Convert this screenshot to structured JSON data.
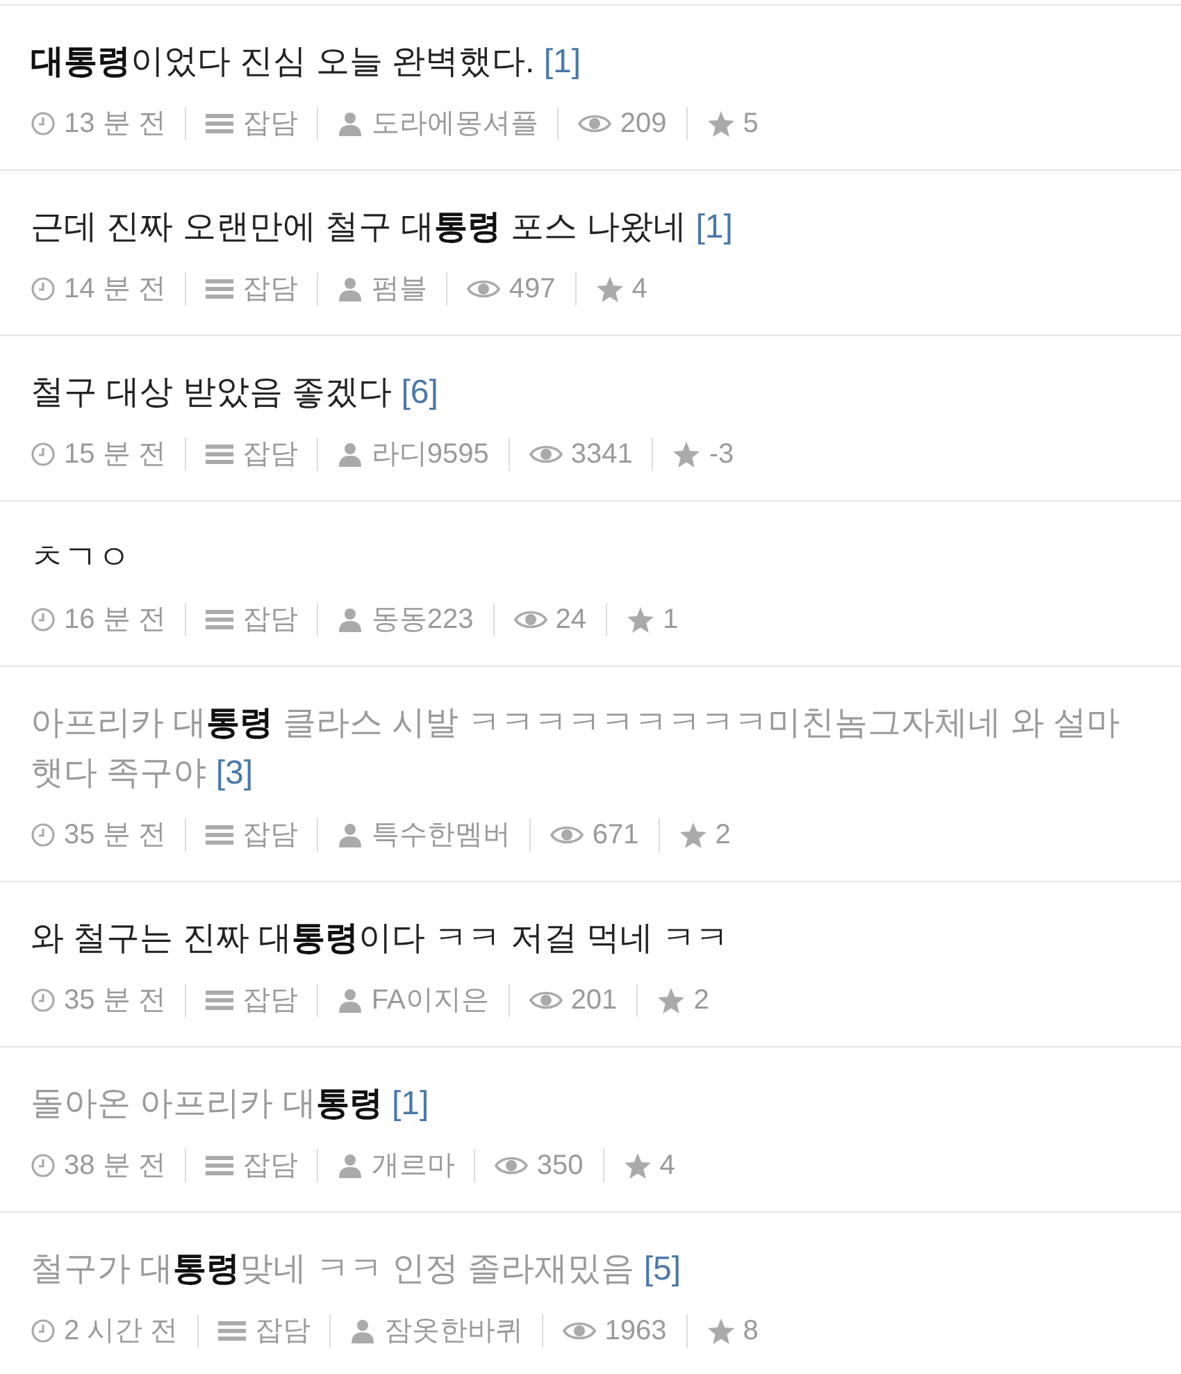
{
  "posts": [
    {
      "title": "**대통령**이었다 진심 오늘 완벽했다.",
      "comments": "[1]",
      "read": false,
      "time": "13 분 전",
      "category": "잡담",
      "author": "도라에몽셔플",
      "views": "209",
      "votes": "5"
    },
    {
      "title": "근데 진짜 오랜만에 철구 대**통령** 포스 나왔네",
      "comments": "[1]",
      "read": false,
      "time": "14 분 전",
      "category": "잡담",
      "author": "펌블",
      "views": "497",
      "votes": "4"
    },
    {
      "title": "철구 대상 받았음 좋겠다",
      "comments": "[6]",
      "read": false,
      "time": "15 분 전",
      "category": "잡담",
      "author": "라디9595",
      "views": "3341",
      "votes": "-3"
    },
    {
      "title": "ㅊㄱㅇ",
      "read": false,
      "time": "16 분 전",
      "category": "잡담",
      "author": "동동223",
      "views": "24",
      "votes": "1"
    },
    {
      "title": "아프리카 대**통령** 클라스 시발 ㅋㅋㅋㅋㅋㅋㅋㅋㅋ미친놈그자체네 와 설마햇다 족구야",
      "comments": "[3]",
      "read": true,
      "time": "35 분 전",
      "category": "잡담",
      "author": "특수한멤버",
      "views": "671",
      "votes": "2"
    },
    {
      "title": "와 철구는 진짜 대**통령**이다 ㅋㅋ 저걸 먹네 ㅋㅋ",
      "read": false,
      "time": "35 분 전",
      "category": "잡담",
      "author": "FA이지은",
      "views": "201",
      "votes": "2"
    },
    {
      "title": "돌아온 아프리카 대**통령**",
      "comments": "[1]",
      "read": true,
      "time": "38 분 전",
      "category": "잡담",
      "author": "개르마",
      "views": "350",
      "votes": "4"
    },
    {
      "title": "철구가 대**통령**맞네 ㅋㅋ 인정 졸라재밌음",
      "comments": "[5]",
      "read": true,
      "time": "2 시간 전",
      "category": "잡담",
      "author": "잠옷한바퀴",
      "views": "1963",
      "votes": "8"
    }
  ]
}
